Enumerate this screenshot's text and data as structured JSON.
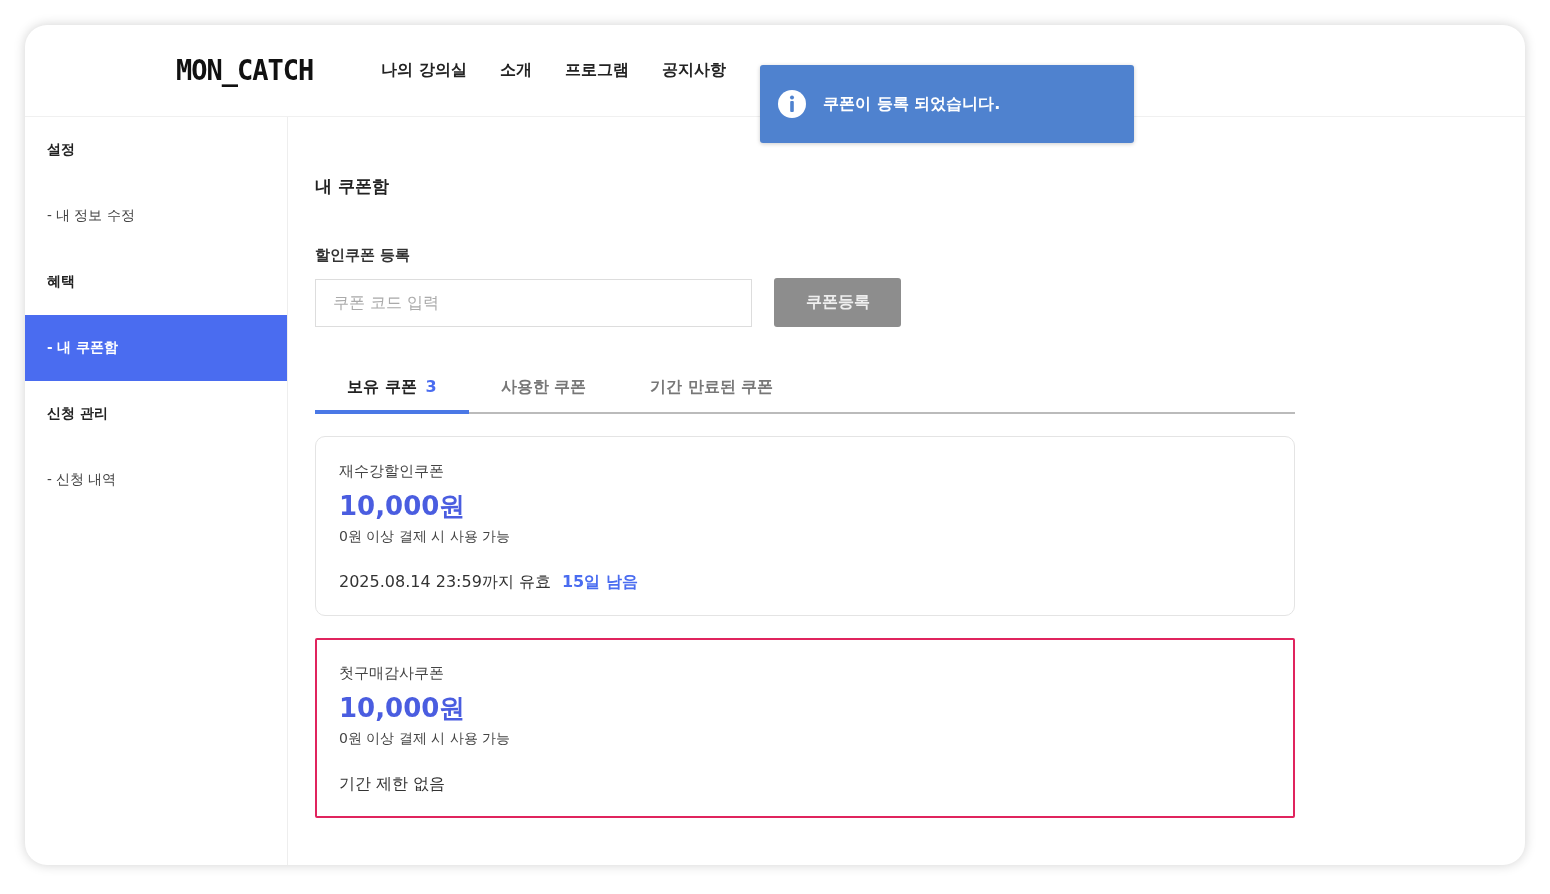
{
  "header": {
    "logo": "MON_CATCH",
    "nav": [
      "나의 강의실",
      "소개",
      "프로그램",
      "공지사항"
    ]
  },
  "toast": {
    "message": "쿠폰이 등록 되었습니다."
  },
  "sidebar": {
    "items": [
      {
        "label": "설정",
        "kind": "heading",
        "selected": false
      },
      {
        "label": "- 내 정보 수정",
        "kind": "sub",
        "selected": false
      },
      {
        "label": "혜택",
        "kind": "heading",
        "selected": false
      },
      {
        "label": "- 내 쿠폰함",
        "kind": "sub",
        "selected": true
      },
      {
        "label": "신청 관리",
        "kind": "heading",
        "selected": false
      },
      {
        "label": "- 신청 내역",
        "kind": "sub",
        "selected": false
      }
    ]
  },
  "page_title": "내 쿠폰함",
  "register": {
    "label": "할인쿠폰 등록",
    "placeholder": "쿠폰 코드 입력",
    "button": "쿠폰등록",
    "disabled": true
  },
  "tabs": [
    {
      "label": "보유 쿠폰",
      "count": "3",
      "selected": true
    },
    {
      "label": "사용한 쿠폰",
      "selected": false
    },
    {
      "label": "기간 만료된 쿠폰",
      "selected": false
    }
  ],
  "coupons": [
    {
      "name": "재수강할인쿠폰",
      "amount": "10,000원",
      "condition": "0원 이상 결제 시 사용 가능",
      "validity": "2025.08.14 23:59까지 유효",
      "remaining": "15일 남음",
      "highlighted": false
    },
    {
      "name": "첫구매감사쿠폰",
      "amount": "10,000원",
      "condition": "0원 이상 결제 시 사용 가능",
      "validity": "기간 제한 없음",
      "highlighted": true
    }
  ]
}
